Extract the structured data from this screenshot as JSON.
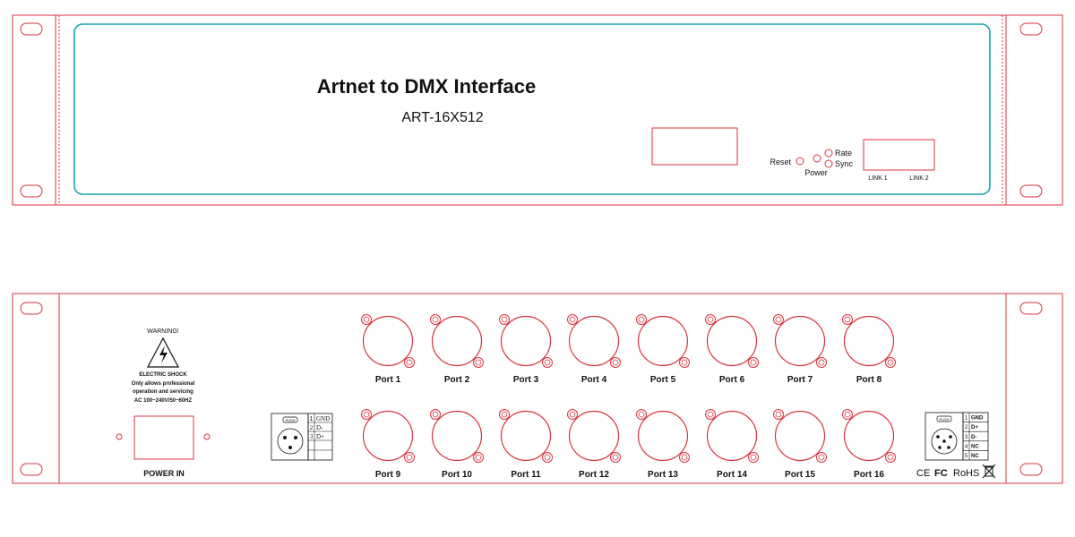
{
  "front_panel": {
    "title": "Artnet to DMX Interface",
    "model": "ART-16X512",
    "indicators": {
      "reset_label": "Reset",
      "power_label": "Power",
      "rate_label": "Rate",
      "sync_label": "Sync"
    },
    "links": [
      "LINK 1",
      "LINK 2"
    ]
  },
  "rear_panel": {
    "warning": {
      "heading": "WARNING!",
      "shock_label": "ELECTRIC SHOCK",
      "note_line1": "Only allows professional",
      "note_line2": "operation and servicing",
      "ac_spec": "AC 100~240V/50~60HZ"
    },
    "power_in_label": "POWER IN",
    "ports_top": [
      "Port 1",
      "Port 2",
      "Port 3",
      "Port 4",
      "Port 5",
      "Port 6",
      "Port 7",
      "Port 8"
    ],
    "ports_bottom": [
      "Port 9",
      "Port 10",
      "Port 11",
      "Port 12",
      "Port 13",
      "Port 14",
      "Port 15",
      "Port 16"
    ],
    "xlr_left": {
      "push_label": "PUSH",
      "pins": [
        {
          "num": "1",
          "name": "GND"
        },
        {
          "num": "2",
          "name": "D-"
        },
        {
          "num": "3",
          "name": "D+"
        }
      ]
    },
    "xlr_right": {
      "push_label": "PUSH",
      "pins": [
        {
          "num": "1",
          "name": "GND"
        },
        {
          "num": "2",
          "name": "D+"
        },
        {
          "num": "3",
          "name": "D-"
        },
        {
          "num": "4",
          "name": "NC"
        },
        {
          "num": "5",
          "name": "NC"
        }
      ]
    },
    "cert_marks": {
      "ce": "CE",
      "fc": "FC",
      "rohs": "RoHS"
    }
  },
  "colors": {
    "outline": "#d9333f",
    "front_frame": "#1aa3b0",
    "text": "#111111"
  }
}
